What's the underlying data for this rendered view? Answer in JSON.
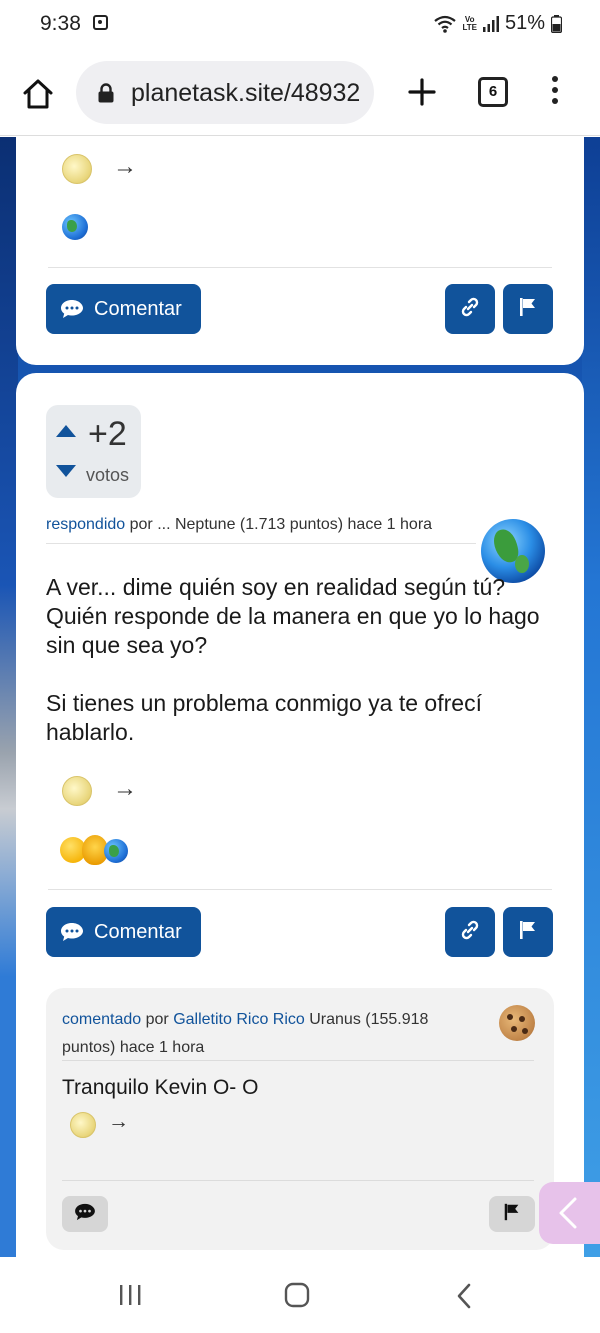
{
  "status_bar": {
    "time": "9:38",
    "lte_top": "Vo",
    "lte_bottom": "LTE",
    "battery": "51%"
  },
  "browser": {
    "url": "planetask.site/48932",
    "tab_count": "6"
  },
  "card_top": {
    "comment_button": "Comentar"
  },
  "answer": {
    "votes": "+2",
    "votes_label": "votos",
    "meta_verb": "respondido",
    "meta_rest": " por ... Neptune (1.713 puntos) hace 1 hora",
    "paragraphs": [
      "A ver... dime quién soy en realidad según tú? Quién responde de la manera en que yo lo hago sin que sea yo?",
      "Si tienes un problema conmigo ya te ofrecí hablarlo."
    ],
    "arrow": "→",
    "comment_button": "Comentar"
  },
  "comment": {
    "meta_verb": "comentado",
    "meta_por": " por ",
    "author": "Galletito Rico Rico",
    "meta_rest": " Uranus (155.918 puntos) hace 1 hora",
    "text": "Tranquilo Kevin O-  O",
    "arrow": "→"
  },
  "colors": {
    "accent": "#11539b",
    "card": "#ffffff",
    "comment_bg": "#f2f2f2",
    "side_tab": "#e7c2ea"
  }
}
